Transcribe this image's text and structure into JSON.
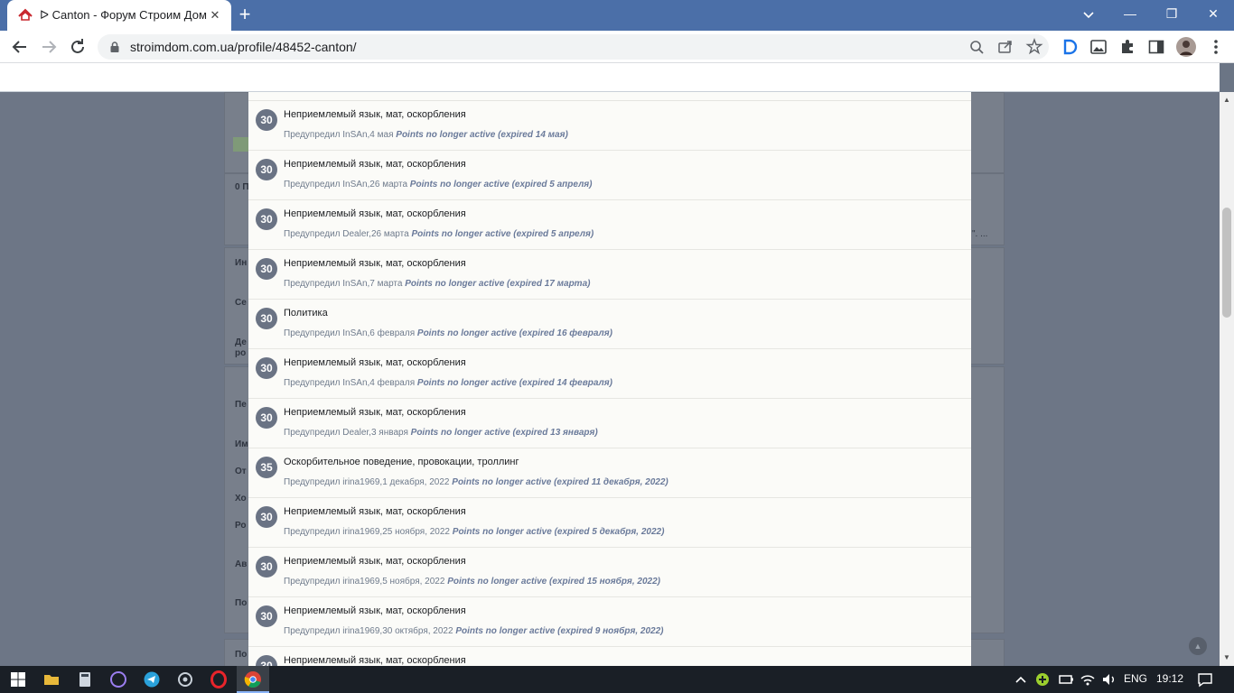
{
  "browser": {
    "tab_title": "ᐅ Canton - Форум Строим Дом",
    "url": "stroimdom.com.ua/profile/48452-canton/",
    "newtab_symbol": "+",
    "close_symbol": "✕",
    "minimize_symbol": "—",
    "maximize_symbol": "❐",
    "window_close_symbol": "✕"
  },
  "warnings": [
    {
      "points": "30",
      "reason": "Неприемлемый язык, мат, оскорбления",
      "meta": "Предупредил InSAn,4 мая",
      "status": "Points no longer active (expired 14 мая)"
    },
    {
      "points": "30",
      "reason": "Неприемлемый язык, мат, оскорбления",
      "meta": "Предупредил InSAn,26 марта",
      "status": "Points no longer active (expired 5 апреля)"
    },
    {
      "points": "30",
      "reason": "Неприемлемый язык, мат, оскорбления",
      "meta": "Предупредил Dealer,26 марта",
      "status": "Points no longer active (expired 5 апреля)"
    },
    {
      "points": "30",
      "reason": "Неприемлемый язык, мат, оскорбления",
      "meta": "Предупредил InSAn,7 марта",
      "status": "Points no longer active (expired 17 марта)"
    },
    {
      "points": "30",
      "reason": "Политика",
      "meta": "Предупредил InSAn,6 февраля",
      "status": "Points no longer active (expired 16 февраля)"
    },
    {
      "points": "30",
      "reason": "Неприемлемый язык, мат, оскорбления",
      "meta": "Предупредил InSAn,4 февраля",
      "status": "Points no longer active (expired 14 февраля)"
    },
    {
      "points": "30",
      "reason": "Неприемлемый язык, мат, оскорбления",
      "meta": "Предупредил Dealer,3 января",
      "status": "Points no longer active (expired 13 января)"
    },
    {
      "points": "35",
      "reason": "Оскорбительное поведение, провокации, троллинг",
      "meta": "Предупредил irina1969,1 декабря, 2022",
      "status": "Points no longer active (expired 11 декабря, 2022)"
    },
    {
      "points": "30",
      "reason": "Неприемлемый язык, мат, оскорбления",
      "meta": "Предупредил irina1969,25 ноября, 2022",
      "status": "Points no longer active (expired 5 декабря, 2022)"
    },
    {
      "points": "30",
      "reason": "Неприемлемый язык, мат, оскорбления",
      "meta": "Предупредил irina1969,5 ноября, 2022",
      "status": "Points no longer active (expired 15 ноября, 2022)"
    },
    {
      "points": "30",
      "reason": "Неприемлемый язык, мат, оскорбления",
      "meta": "Предупредил irina1969,30 октября, 2022",
      "status": "Points no longer active (expired 9 ноября, 2022)"
    },
    {
      "points": "30",
      "reason": "Неприемлемый язык, мат, оскорбления",
      "meta": "",
      "status": ""
    }
  ],
  "background_labels": {
    "l1": "0 П",
    "l2": "Ин",
    "l3": "Се",
    "l4": "Де",
    "l4b": "ро",
    "l5": "Пе",
    "l6": "Им",
    "l7": "От",
    "l8": "Хо",
    "l9": "Ро",
    "l10": "Ав",
    "l11": "По",
    "l12": "По",
    "snippet": "\". ..."
  },
  "taskbar": {
    "language": "ENG",
    "time": "19:12"
  },
  "colors": {
    "chrome_frame": "#4b6fa8",
    "badge": "#6a7384",
    "status_text": "#6a7a9a"
  }
}
